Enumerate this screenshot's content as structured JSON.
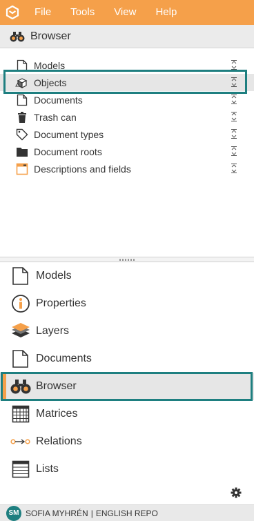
{
  "menu": {
    "file": "File",
    "tools": "Tools",
    "view": "View",
    "help": "Help"
  },
  "colors": {
    "accent": "#f5a04a",
    "highlight": "#1e7f80"
  },
  "panel": {
    "title": "Browser",
    "icon": "binoculars-icon"
  },
  "tree": {
    "items": [
      {
        "label": "Models",
        "icon": "document-icon"
      },
      {
        "label": "Objects",
        "icon": "cubes-icon",
        "selected": true
      },
      {
        "label": "Documents",
        "icon": "document-icon"
      },
      {
        "label": "Trash can",
        "icon": "trash-icon"
      },
      {
        "label": "Document types",
        "icon": "tag-icon"
      },
      {
        "label": "Document roots",
        "icon": "folder-icon"
      },
      {
        "label": "Descriptions and fields",
        "icon": "window-icon"
      }
    ]
  },
  "nav": {
    "items": [
      {
        "label": "Models",
        "icon": "document-icon"
      },
      {
        "label": "Properties",
        "icon": "info-icon"
      },
      {
        "label": "Layers",
        "icon": "layers-icon"
      },
      {
        "label": "Documents",
        "icon": "document-icon"
      },
      {
        "label": "Browser",
        "icon": "binoculars-icon",
        "active": true
      },
      {
        "label": "Matrices",
        "icon": "grid-icon"
      },
      {
        "label": "Relations",
        "icon": "relations-icon"
      },
      {
        "label": "Lists",
        "icon": "list-icon"
      }
    ]
  },
  "footer": {
    "initials": "SM",
    "user": "SOFIA MYHRÉN",
    "separator": "|",
    "repo": "ENGLISH REPO"
  }
}
